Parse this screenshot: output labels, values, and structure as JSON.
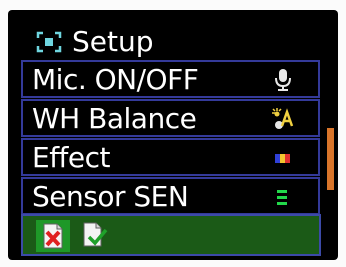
{
  "menu": {
    "title": "Setup",
    "title_icon": "setup-grid-icon",
    "items": [
      {
        "label": "Mic. ON/OFF",
        "icon": "microphone-icon"
      },
      {
        "label": "WH Balance",
        "icon": "white-balance-icon"
      },
      {
        "label": "Effect",
        "icon": "effect-color-bars-icon"
      },
      {
        "label": "Sensor SEN",
        "icon": "sensor-level-icon"
      }
    ],
    "actions": {
      "cancel_icon": "cancel-document-icon",
      "confirm_icon": "confirm-document-icon"
    }
  },
  "colors": {
    "background": "#000000",
    "row_border": "#343a9a",
    "highlight_row": "#1b5a17",
    "scroll_thumb": "#d9752a",
    "text": "#ffffff"
  }
}
